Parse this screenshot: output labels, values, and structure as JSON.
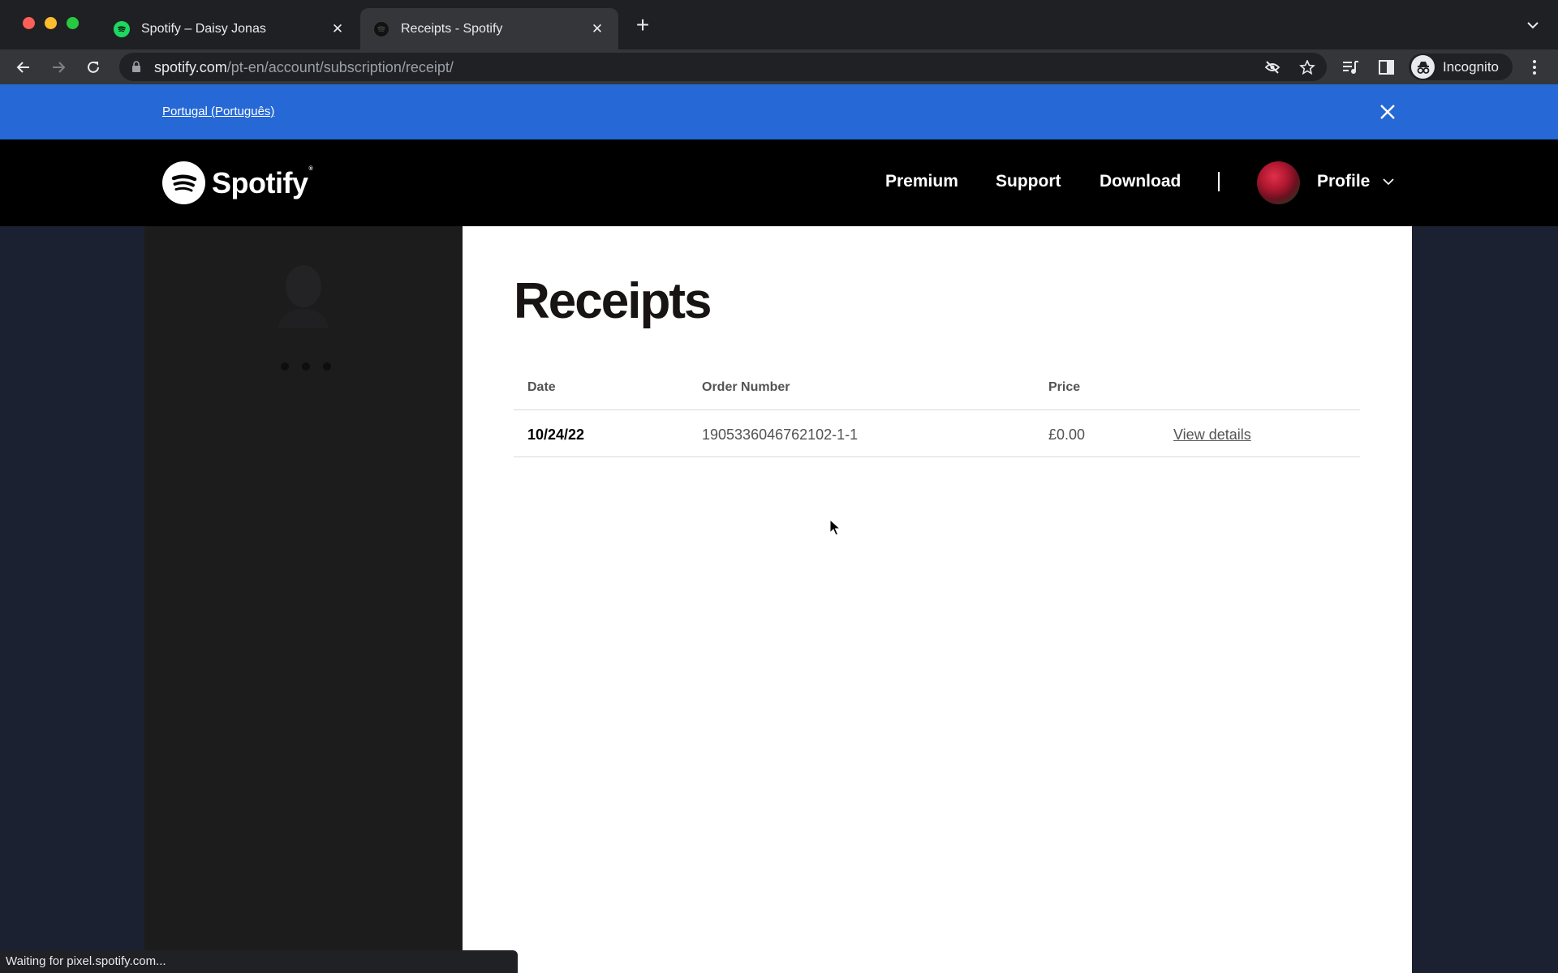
{
  "browser": {
    "tabs": [
      {
        "title": "Spotify – Daisy Jonas",
        "favicon": "spotify-green-icon",
        "active": false
      },
      {
        "title": "Receipts - Spotify",
        "favicon": "spotify-dark-icon",
        "active": true
      }
    ],
    "new_tab_label": "+",
    "close_glyph": "✕",
    "url_host": "spotify.com",
    "url_path": "/pt-en/account/subscription/receipt/",
    "profile_label": "Incognito",
    "status_text": "Waiting for pixel.spotify.com..."
  },
  "banner": {
    "locale_link": "Portugal (Português)",
    "close_icon": "close-icon"
  },
  "header": {
    "brand": "Spotify",
    "brand_reg": "®",
    "nav": {
      "premium": "Premium",
      "support": "Support",
      "download": "Download"
    },
    "profile_label": "Profile"
  },
  "page": {
    "title": "Receipts",
    "columns": {
      "date": "Date",
      "order": "Order Number",
      "price": "Price"
    },
    "rows": [
      {
        "date": "10/24/22",
        "order": "1905336046762102-1-1",
        "price": "£0.00",
        "action": "View details"
      }
    ]
  },
  "colors": {
    "banner_blue": "#2568d6",
    "header_black": "#000000",
    "spotify_green": "#1ed760",
    "page_bg": "#1b2130"
  }
}
